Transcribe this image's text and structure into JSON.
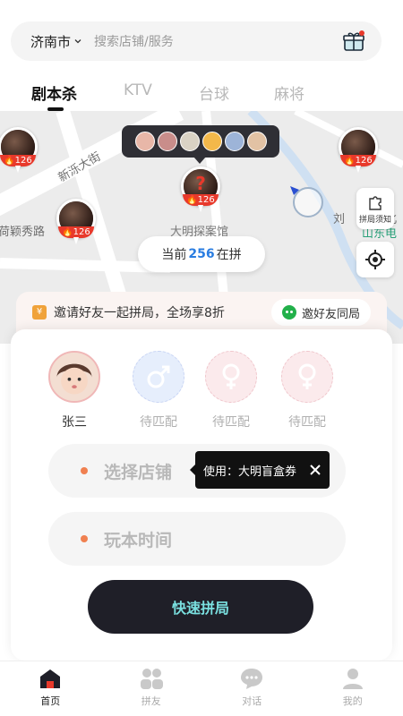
{
  "search": {
    "city": "济南市",
    "placeholder": "搜索店铺/服务"
  },
  "tabs": [
    {
      "label": "剧本杀",
      "active": true
    },
    {
      "label": "KTV",
      "active": false
    },
    {
      "label": "台球",
      "active": false
    },
    {
      "label": "麻将",
      "active": false
    }
  ],
  "map": {
    "road_labels": [
      "新泺大街",
      "荷颖秀路",
      "刘",
      "北",
      "山东电"
    ],
    "store_name": "大明探案馆",
    "pin_badge": "126",
    "count": {
      "prefix": "当前",
      "number": "256",
      "suffix": "在拼"
    },
    "rules_button": "拼局须知"
  },
  "invite": {
    "text": "邀请好友一起拼局，全场享8折",
    "button": "邀好友同局"
  },
  "slots": [
    {
      "name": "张三",
      "kind": "user"
    },
    {
      "name": "待匹配",
      "kind": "male"
    },
    {
      "name": "待匹配",
      "kind": "female"
    },
    {
      "name": "待匹配",
      "kind": "female"
    }
  ],
  "form": {
    "store_field": "选择店铺",
    "time_field": "玩本时间",
    "tooltip": "使用：大明盲盒券",
    "quick_button": "快速拼局"
  },
  "nav": [
    {
      "label": "首页",
      "icon": "home-icon",
      "active": true
    },
    {
      "label": "拼友",
      "icon": "friends-icon",
      "active": false
    },
    {
      "label": "对话",
      "icon": "chat-icon",
      "active": false
    },
    {
      "label": "我的",
      "icon": "profile-icon",
      "active": false
    }
  ],
  "colors": {
    "accent_red": "#e8392b",
    "accent_blue": "#2a7de1",
    "dark_button": "#1f1f28",
    "button_text": "#7ae0e0"
  }
}
